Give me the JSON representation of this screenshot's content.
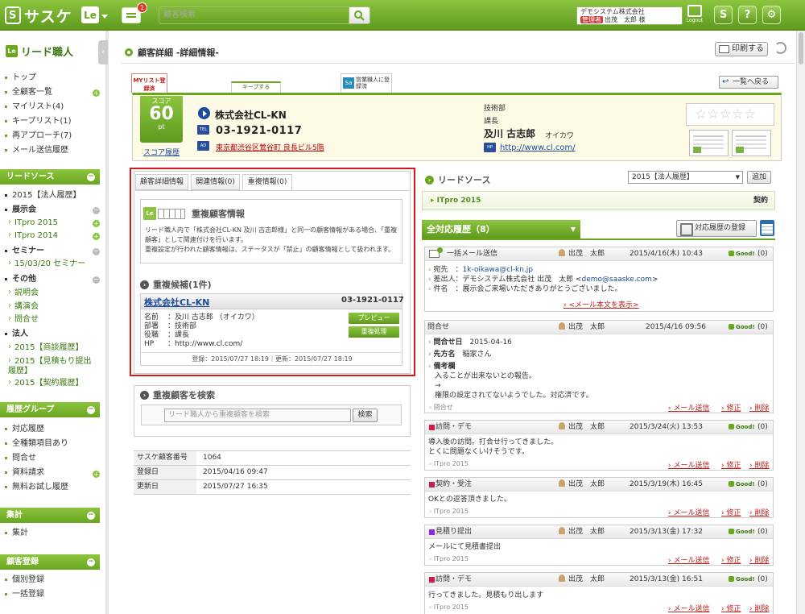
{
  "topbar": {
    "logo_text": "サスケ",
    "app_badge": "Le",
    "message_count": "1",
    "search_placeholder": "顧客検索",
    "user_company": "デモシステム株式会社",
    "user_role": "管理者",
    "user_name": "出茂　太郎 様",
    "logout_label": "Logout",
    "icons": [
      "sync-icon",
      "help-icon",
      "settings-icon"
    ]
  },
  "sidebar": {
    "title": "リード職人",
    "items": [
      {
        "label": "トップ"
      },
      {
        "label": "全顧客一覧"
      },
      {
        "label": "マイリスト(4)"
      },
      {
        "label": "キープリスト(1)"
      },
      {
        "label": "再アプローチ(7)"
      },
      {
        "label": "メール送信履歴"
      }
    ],
    "lead_source": {
      "header": "リードソース",
      "items": [
        "2015【法人履歴】",
        "展示会",
        "ITpro 2015",
        "ITpro 2014",
        "セミナー",
        "15/03/20 セミナー",
        "その他",
        "説明会",
        "講演会",
        "問合せ",
        "法人",
        "2015【商談履歴】",
        "2015【見積もり提出履歴】",
        "2015【契約履歴】"
      ]
    },
    "history_group": {
      "header": "履歴グループ",
      "items": [
        "対応履歴",
        "全種類項目あり",
        "問合せ",
        "資料請求",
        "無料お試し履歴"
      ]
    },
    "totals": {
      "header": "集計",
      "items": [
        "集計"
      ]
    },
    "customer_reg": {
      "header": "顧客登録",
      "items": [
        "個別登録",
        "一括登録"
      ]
    }
  },
  "header": {
    "page_title": "顧客詳細 -詳細情報-",
    "print_label": "印刷する",
    "back_label": "一覧へ戻る",
    "tags": [
      "MYリスト登録済",
      "キープする",
      "営業職人に登録済"
    ]
  },
  "company": {
    "score_label": "スコア",
    "score_value": "60",
    "score_unit": "pt",
    "score_history_link": "スコア履歴",
    "name": "株式会社CL-KN",
    "tel": "03-1921-0117",
    "address": "東京都渋谷区鶯谷町 良長ビル5階",
    "department": "技術部",
    "title": "課長",
    "person_name": "及川 古志郎",
    "person_kana": "オイカワ",
    "url": "http://www.cl.com/",
    "stars": "☆☆☆☆☆",
    "icon_labels": {
      "tel": "TEL",
      "address": "AD",
      "hp": "HP"
    }
  },
  "left_panel": {
    "tabs": [
      "顧客詳細情報",
      "関連情報(0)",
      "重複情報(0)"
    ],
    "dup_title": "重複顧客情報",
    "dup_text_1": "リード職人内で「株式会社CL-KN 及川 古志郎様」と同一の顧客情報がある場合、「重複顧客」として関連付けを行います。",
    "dup_text_2": "重複設定が行われた顧客情報は、ステータスが「禁止」の顧客情報として扱われます。",
    "candidates_header": "重複候補(1件)",
    "candidate": {
      "name": "株式会社CL-KN",
      "tel": "03-1921-0117",
      "rows": [
        {
          "k": "名前",
          "v": "：及川 古志郎 （オイカワ）"
        },
        {
          "k": "部署",
          "v": "：技術部"
        },
        {
          "k": "役職",
          "v": "：課長"
        },
        {
          "k": "HP",
          "v": "：http://www.cl.com/"
        }
      ],
      "preview_label": "プレビュー",
      "dup_process_label": "重複処理",
      "meta": "登録：2015/07/27 18:19｜更新：2015/07/27 18:19"
    },
    "search_header": "重複顧客を検索",
    "search_placeholder": "リード職人から重複顧客を検索",
    "search_button": "検索",
    "info": [
      {
        "k": "サスケ顧客番号",
        "v": "1064"
      },
      {
        "k": "登録日",
        "v": "2015/04/16 09:47"
      },
      {
        "k": "更新日",
        "v": "2015/07/27 16:35"
      }
    ]
  },
  "right_panel": {
    "lead_source_title": "リードソース",
    "select_value": "2015【法人履歴】",
    "add_label": "追加",
    "lead_row": {
      "name": "ITpro 2015",
      "type": "契約"
    },
    "history_tab": "全対応履歴（8）",
    "history_reg_label": "対応履歴の登録",
    "entries": [
      {
        "type": "一括メール送信",
        "user": "出茂　太郎",
        "date": "2015/4/16(木) 10:43",
        "good": "Good!",
        "count": "(0)",
        "to_label": "宛先",
        "to": "1k-oikawa@cl-kn.jp",
        "from_label": "差出人",
        "from": "：デモシステム株式会社 出茂　太郎 <",
        "from_mail": "demo@saaske.com",
        "from_end": ">",
        "subject_label": "件名",
        "subject": "：展示会ご来場いただきありがとうございました。",
        "show_body": "<メール本文を表示>"
      },
      {
        "type": "問合せ",
        "user": "出茂　太郎",
        "date": "2015/4/16 09:56",
        "good": "Good!",
        "count": "(0)",
        "inq_date_label": "問合せ日",
        "inq_date": "2015-04-16",
        "to_label": "先方名",
        "to": "稲家さん",
        "note_label": "備考欄",
        "note_1": "入ることが出来ないとの報告。",
        "note_2": "→",
        "note_3": "権限の設定されてないようでした。対応済です。",
        "source": "問合せ"
      },
      {
        "type": "訪問・デモ",
        "color": "#d8184b",
        "user": "出茂　太郎",
        "date": "2015/3/24(火) 13:53",
        "good": "Good!",
        "count": "(0)",
        "body_1": "導入後の訪問。打合せ行ってきました。",
        "body_2": "とくに問題なくいけそうです。",
        "source": "ITpro 2015"
      },
      {
        "type": "契約・受注",
        "color": "#c02058",
        "user": "出茂　太郎",
        "date": "2015/3/19(木) 16:45",
        "good": "Good!",
        "count": "(0)",
        "body_1": "OKとの返答頂きました。",
        "source": "ITpro 2015"
      },
      {
        "type": "見積り提出",
        "color": "#8a2ad8",
        "user": "出茂　太郎",
        "date": "2015/3/13(金) 17:32",
        "good": "Good!",
        "count": "(0)",
        "body_1": "メールにて見積書提出",
        "source": "ITpro 2015"
      },
      {
        "type": "訪問・デモ",
        "color": "#d8184b",
        "user": "出茂　太郎",
        "date": "2015/3/13(金) 16:51",
        "good": "Good!",
        "count": "(0)",
        "body_1": "行ってきました。見積もり出します",
        "source": "ITpro 2015"
      }
    ],
    "actions": {
      "mail": "メール送信",
      "edit": "修正",
      "delete": "削除"
    }
  }
}
